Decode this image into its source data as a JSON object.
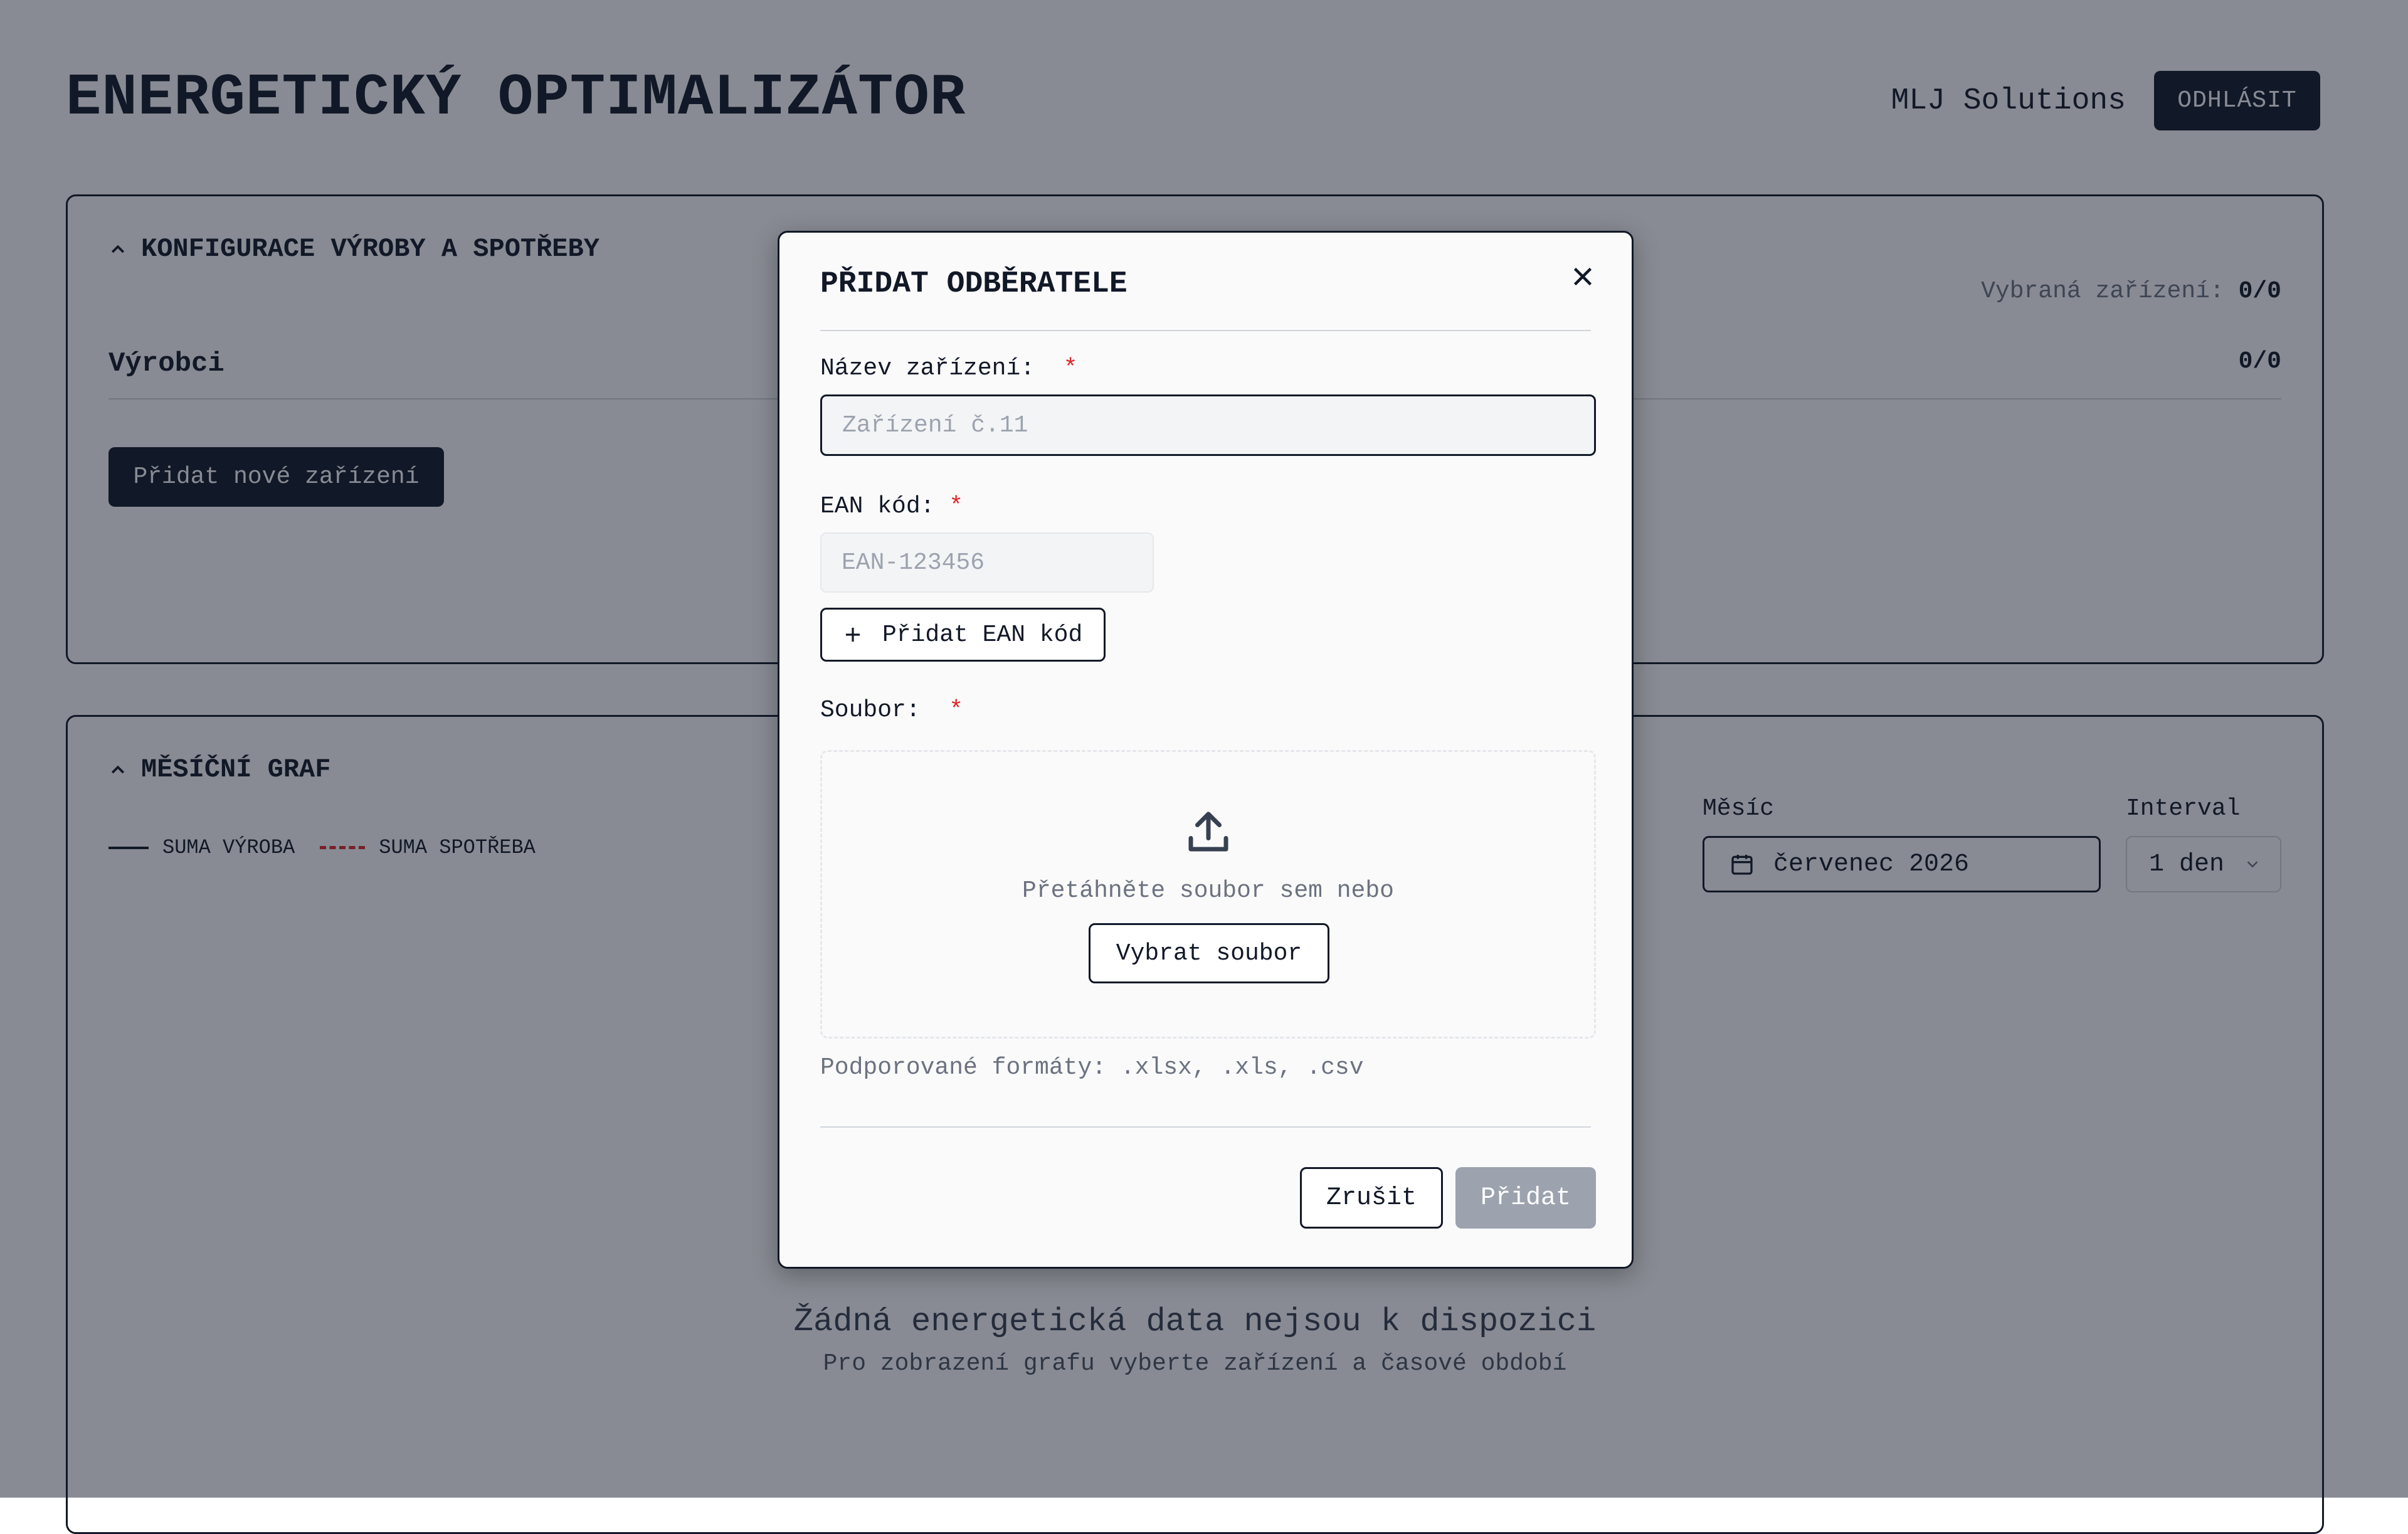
{
  "app": {
    "title": "ENERGETICKÝ OPTIMALIZÁTOR",
    "user": "MLJ Solutions",
    "logout_label": "ODHLÁSIT"
  },
  "config_panel": {
    "title": "KONFIGURACE VÝROBY A SPOTŘEBY",
    "selected_label": "Vybraná zařízení:",
    "selected_value": "0/0",
    "producers_label": "Výrobci",
    "producers_count": "0/0",
    "add_device_label": "Přidat nové zařízení"
  },
  "graph_panel": {
    "title": "MĚSÍČNÍ GRAF",
    "legend": [
      {
        "label": "SUMA VÝROBA",
        "color": "#111827",
        "style": "solid"
      },
      {
        "label": "SUMA SPOTŘEBA",
        "color": "#dc2626",
        "style": "dashed"
      }
    ],
    "month_label": "Měsíc",
    "month_value": "červenec 2026",
    "interval_label": "Interval",
    "interval_value": "1 den",
    "empty_title": "Žádná energetická data nejsou k dispozici",
    "empty_subtitle": "Pro zobrazení grafu vyberte zařízení a časové období"
  },
  "modal": {
    "title": "PŘIDAT ODBĚRATELE",
    "name_label": "Název zařízení:",
    "name_placeholder": "Zařízení č.11",
    "ean_label": "EAN kód:",
    "ean_placeholder": "EAN-123456",
    "add_ean_label": "Přidat EAN kód",
    "file_label": "Soubor:",
    "required_mark": "*",
    "drop_text": "Přetáhněte soubor sem nebo",
    "choose_label": "Vybrat soubor",
    "formats": "Podporované formáty: .xlsx, .xls, .csv",
    "cancel_label": "Zrušit",
    "submit_label": "Přidat"
  },
  "colors": {
    "primary": "#111827",
    "required": "#dc2626",
    "disabled": "#9ca3af",
    "overlay": "rgba(17,24,39,0.5)"
  },
  "icons": [
    "chevron-up-icon",
    "calendar-icon",
    "chevron-down-icon",
    "close-icon",
    "plus-icon",
    "upload-icon"
  ]
}
